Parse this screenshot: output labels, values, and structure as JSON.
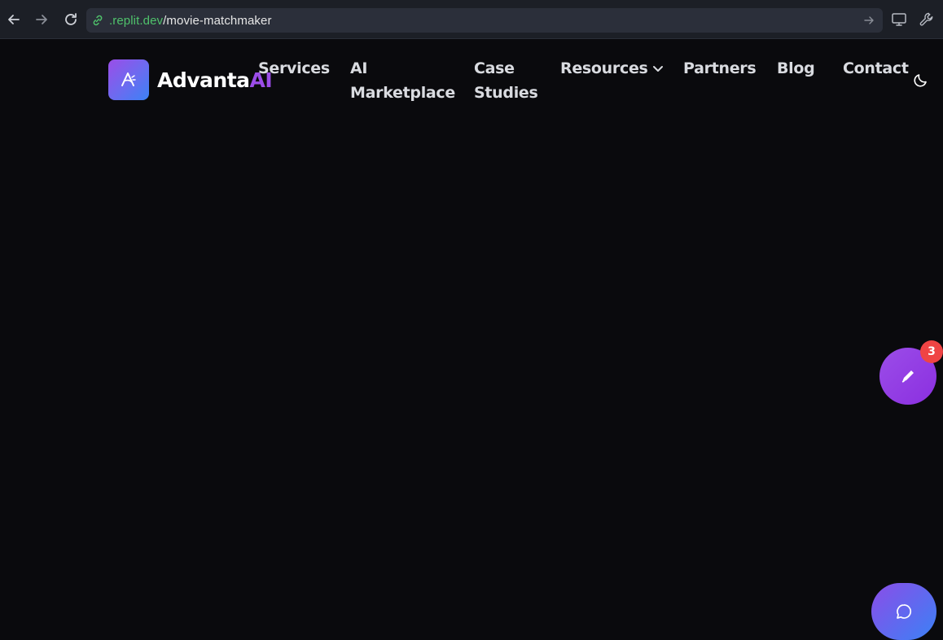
{
  "browser": {
    "url_domain": ".replit.dev",
    "url_path": "/movie-matchmaker",
    "icons": [
      "back-arrow-icon",
      "forward-arrow-icon",
      "reload-icon",
      "link-icon",
      "go-arrow-icon",
      "monitor-icon",
      "wrench-icon"
    ]
  },
  "site": {
    "logo_text": "Advanta",
    "logo_accent": "AI",
    "nav": {
      "services": "Services",
      "ai_line1": "AI",
      "ai_line2": "Marketplace",
      "case_line1": "Case",
      "case_line2": "Studies",
      "resources": "Resources",
      "partners": "Partners",
      "blog": "Blog",
      "contact": "Contact"
    }
  },
  "widgets": {
    "edit_badge": "3"
  },
  "colors": {
    "background": "#0a0a0d",
    "accent_purple": "#9b4de8",
    "accent_blue": "#3b82f6",
    "badge_red": "#ef4444",
    "url_domain_green": "#4fc26b"
  }
}
